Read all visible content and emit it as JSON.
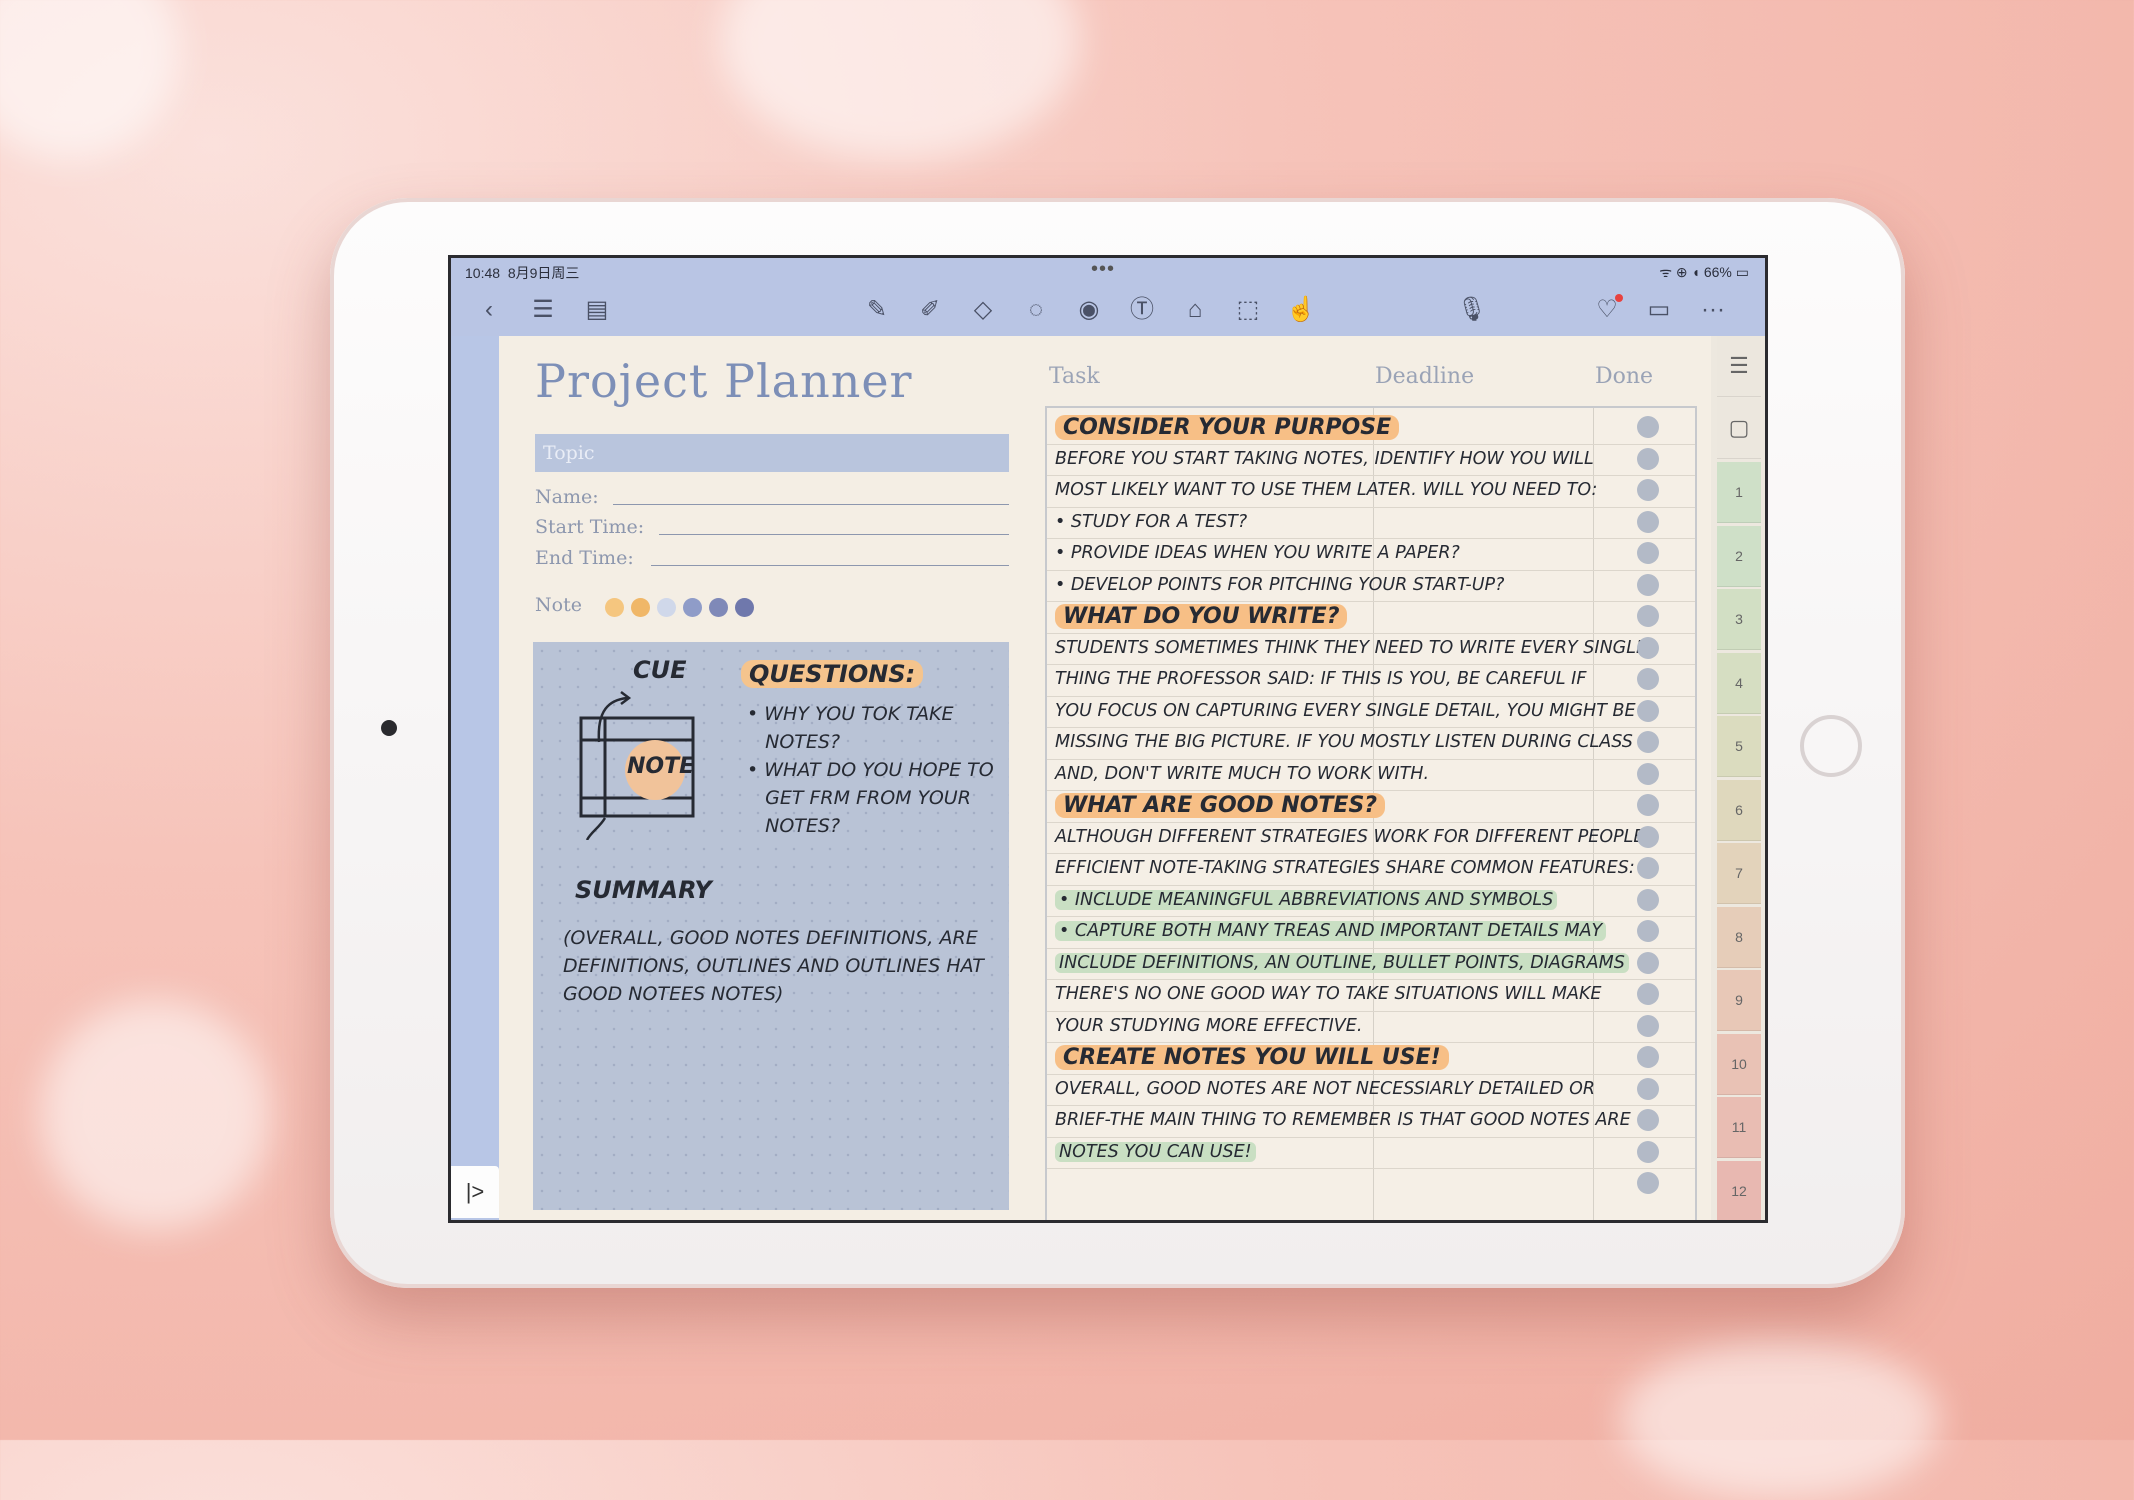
{
  "status": {
    "time": "10:48",
    "date": "8月9日周三",
    "battery": "66%",
    "indicators": "ᯤ ⊕ ◖"
  },
  "toolbar": {
    "left_icons": [
      "back-icon",
      "list-icon",
      "outline-icon"
    ],
    "center_icons": [
      "pen-icon",
      "highlighter-icon",
      "eraser-icon",
      "lasso-icon",
      "sticker-icon",
      "text-icon",
      "shape-icon",
      "crop-icon",
      "hand-icon"
    ],
    "right_icons": [
      "microphone-icon",
      "collaborate-icon",
      "comment-icon",
      "more-icon"
    ],
    "more_label": "···"
  },
  "page": {
    "title": "Project Planner",
    "topic_placeholder": "Topic",
    "name_label": "Name:",
    "start_label": "Start Time:",
    "end_label": "End Time:",
    "note_label": "Note",
    "note_colors": [
      "#f5c67f",
      "#f0b768",
      "#d0d8ea",
      "#8f9cc8",
      "#7f89b8",
      "#6f78ac"
    ]
  },
  "cue": {
    "cue_label": "CUE",
    "note_label": "NOTE",
    "summary_label": "SUMMARY",
    "questions_label": "QUESTIONS:",
    "questions": [
      "WHY YOU TOK TAKE",
      "NOTES?",
      "WHAT DO YOU HOPE TO",
      "GET FRM FROM YOUR",
      "NOTES?"
    ],
    "summary_text": [
      "(OVERALL, GOOD NOTES DEFINITIONS, ARE",
      "DEFINITIONS, OUTLINES AND OUTLINES HAT",
      "GOOD NOTEES NOTES)"
    ]
  },
  "tasks": {
    "headers": {
      "task": "Task",
      "deadline": "Deadline",
      "done": "Done"
    },
    "rows": [
      {
        "text": "CONSIDER YOUR PURPOSE",
        "type": "heading"
      },
      {
        "text": "BEFORE YOU START TAKING NOTES, IDENTIFY HOW YOU WILL",
        "type": "text"
      },
      {
        "text": "MOST LIKELY WANT TO USE THEM LATER. WILL YOU NEED TO:",
        "type": "text"
      },
      {
        "text": "• STUDY FOR A TEST?",
        "type": "text"
      },
      {
        "text": "• PROVIDE IDEAS WHEN YOU WRITE A PAPER?",
        "type": "text"
      },
      {
        "text": "• DEVELOP POINTS FOR PITCHING YOUR START-UP?",
        "type": "text"
      },
      {
        "text": "WHAT DO YOU WRITE?",
        "type": "heading"
      },
      {
        "text": "STUDENTS SOMETIMES THINK THEY NEED TO WRITE EVERY SINGLE",
        "type": "text"
      },
      {
        "text": "THING THE PROFESSOR SAID: IF THIS IS YOU, BE CAREFUL IF",
        "type": "text"
      },
      {
        "text": "YOU FOCUS ON CAPTURING EVERY SINGLE DETAIL, YOU MIGHT BE",
        "type": "text"
      },
      {
        "text": "MISSING THE BIG PICTURE. IF YOU MOSTLY LISTEN DURING CLASS",
        "type": "text"
      },
      {
        "text": "AND, DON'T WRITE  MUCH TO WORK WITH.",
        "type": "text"
      },
      {
        "text": "WHAT ARE GOOD NOTES?",
        "type": "heading"
      },
      {
        "text": "ALTHOUGH DIFFERENT STRATEGIES WORK FOR DIFFERENT PEOPLE,",
        "type": "text"
      },
      {
        "text": "EFFICIENT NOTE-TAKING STRATEGIES SHARE COMMON FEATURES:",
        "type": "text"
      },
      {
        "text": "• INCLUDE MEANINGFUL ABBREVIATIONS AND SYMBOLS",
        "type": "green"
      },
      {
        "text": "• CAPTURE BOTH MANY TREAS AND IMPORTANT DETAILS MAY",
        "type": "green"
      },
      {
        "text": "  INCLUDE DEFINITIONS, AN OUTLINE, BULLET POINTS, DIAGRAMS",
        "type": "green"
      },
      {
        "text": "  THERE'S NO ONE GOOD WAY TO TAKE SITUATIONS WILL MAKE",
        "type": "text"
      },
      {
        "text": "  YOUR STUDYING MORE EFFECTIVE.",
        "type": "text"
      },
      {
        "text": "CREATE NOTES YOU WILL USE!",
        "type": "heading"
      },
      {
        "text": "OVERALL, GOOD NOTES ARE NOT NECESSIARLY DETAILED OR",
        "type": "text"
      },
      {
        "text": "BRIEF-THE MAIN THING TO REMEMBER IS THAT GOOD NOTES ARE",
        "type": "text"
      },
      {
        "text": "NOTES YOU CAN USE!",
        "type": "green"
      }
    ],
    "done_count": 25
  },
  "side_tabs": {
    "top_icons": [
      "menu-icon",
      "note-icon"
    ],
    "numbers": [
      "1",
      "2",
      "3",
      "4",
      "5",
      "6",
      "7",
      "8",
      "9",
      "10",
      "11",
      "12"
    ],
    "colors": [
      "#cfe0c8",
      "#cfe0c8",
      "#d2dfc4",
      "#d6dec2",
      "#dbdcbf",
      "#dfd8bd",
      "#e3d3bb",
      "#e6cdb9",
      "#e8c8b7",
      "#e9c2b5",
      "#e9bdb3",
      "#e8b8b1"
    ]
  },
  "expand_label": "|>"
}
